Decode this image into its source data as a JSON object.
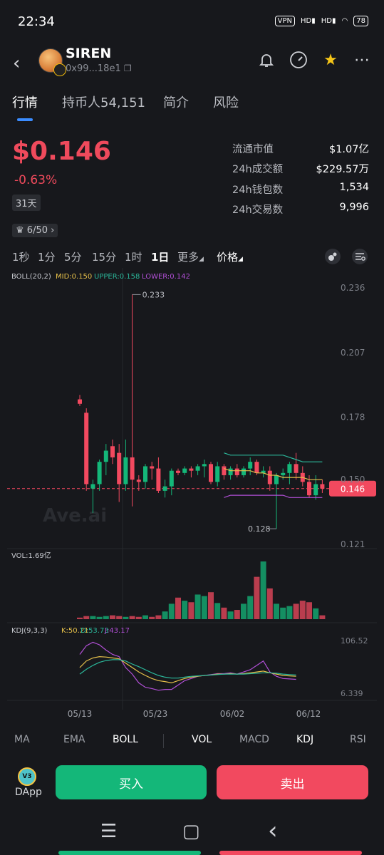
{
  "status_bar": {
    "time": "22:34",
    "vpn": "VPN",
    "hd1": "HD",
    "hd2": "HD",
    "battery": "78"
  },
  "header": {
    "back_icon": "chevron-left-icon",
    "token_name": "SIREN",
    "address": "0x99...18e1",
    "icons": [
      "copy-icon",
      "bell-icon",
      "speedometer-icon",
      "star-icon",
      "more-icon"
    ]
  },
  "tabs": [
    {
      "label": "行情",
      "active": true
    },
    {
      "label": "持币人54,151",
      "active": false
    },
    {
      "label": "简介",
      "active": false
    },
    {
      "label": "风险",
      "active": false
    }
  ],
  "price": {
    "value": "$0.146",
    "change": "-0.63%",
    "period": "31天",
    "rank": "6/50"
  },
  "stats": [
    {
      "key": "流通市值",
      "value": "$1.07亿"
    },
    {
      "key": "24h成交额",
      "value": "$229.57万"
    },
    {
      "key": "24h钱包数",
      "value": "1,534"
    },
    {
      "key": "24h交易数",
      "value": "9,996"
    }
  ],
  "intervals": [
    {
      "label": "1秒",
      "active": false
    },
    {
      "label": "1分",
      "active": false
    },
    {
      "label": "5分",
      "active": false
    },
    {
      "label": "15分",
      "active": false
    },
    {
      "label": "1时",
      "active": false
    },
    {
      "label": "1日",
      "active": true
    },
    {
      "label": "更多",
      "active": false
    },
    {
      "label": "价格",
      "active": false
    }
  ],
  "chart_data": {
    "type": "candlestick",
    "boll": {
      "label": "BOLL(20,2)",
      "mid": "MID:0.150",
      "upper": "UPPER:0.158",
      "lower": "LOWER:0.142"
    },
    "price_axis": [
      "0.236",
      "0.207",
      "0.178",
      "0.150",
      "0.121"
    ],
    "ylim": [
      0.121,
      0.236
    ],
    "current_price": "0.146",
    "high_label": "0.233",
    "low_label": "0.128",
    "watermark": "Ave.ai",
    "dates": [
      "05/13",
      "05/23",
      "06/02",
      "06/12"
    ],
    "candles": [
      [
        0.186,
        0.188,
        0.183,
        0.184
      ],
      [
        0.18,
        0.182,
        0.145,
        0.148
      ],
      [
        0.146,
        0.15,
        0.135,
        0.148
      ],
      [
        0.148,
        0.159,
        0.145,
        0.158
      ],
      [
        0.158,
        0.166,
        0.152,
        0.163
      ],
      [
        0.165,
        0.168,
        0.157,
        0.16
      ],
      [
        0.162,
        0.166,
        0.14,
        0.148
      ],
      [
        0.148,
        0.168,
        0.145,
        0.16
      ],
      [
        0.16,
        0.233,
        0.138,
        0.15
      ],
      [
        0.15,
        0.152,
        0.145,
        0.149
      ],
      [
        0.149,
        0.157,
        0.146,
        0.156
      ],
      [
        0.156,
        0.158,
        0.15,
        0.155
      ],
      [
        0.155,
        0.16,
        0.144,
        0.145
      ],
      [
        0.145,
        0.15,
        0.142,
        0.147
      ],
      [
        0.147,
        0.155,
        0.143,
        0.154
      ],
      [
        0.154,
        0.155,
        0.152,
        0.153
      ],
      [
        0.153,
        0.156,
        0.152,
        0.155
      ],
      [
        0.155,
        0.156,
        0.151,
        0.154
      ],
      [
        0.154,
        0.157,
        0.152,
        0.156
      ],
      [
        0.156,
        0.159,
        0.151,
        0.157
      ],
      [
        0.157,
        0.158,
        0.148,
        0.149
      ],
      [
        0.149,
        0.158,
        0.147,
        0.156
      ],
      [
        0.156,
        0.157,
        0.15,
        0.152
      ],
      [
        0.152,
        0.156,
        0.15,
        0.155
      ],
      [
        0.155,
        0.157,
        0.151,
        0.152
      ],
      [
        0.152,
        0.156,
        0.151,
        0.155
      ],
      [
        0.155,
        0.16,
        0.152,
        0.158
      ],
      [
        0.158,
        0.159,
        0.152,
        0.153
      ],
      [
        0.153,
        0.156,
        0.151,
        0.154
      ],
      [
        0.154,
        0.156,
        0.145,
        0.148
      ],
      [
        0.148,
        0.153,
        0.128,
        0.152
      ],
      [
        0.152,
        0.155,
        0.15,
        0.153
      ],
      [
        0.153,
        0.158,
        0.148,
        0.157
      ],
      [
        0.157,
        0.162,
        0.15,
        0.153
      ],
      [
        0.153,
        0.156,
        0.147,
        0.149
      ],
      [
        0.149,
        0.152,
        0.142,
        0.143
      ],
      [
        0.143,
        0.152,
        0.141,
        0.148
      ],
      [
        0.148,
        0.15,
        0.144,
        0.146
      ]
    ],
    "boll_mid": [
      0.15,
      0.15,
      0.15,
      0.15,
      0.15,
      0.15,
      0.15,
      0.15,
      0.15,
      0.15,
      0.15,
      0.15,
      0.15,
      0.15,
      0.15,
      0.15,
      0.15,
      0.15,
      0.15,
      0.154,
      0.155,
      0.155,
      0.155,
      0.154,
      0.154,
      0.154,
      0.154,
      0.153,
      0.153,
      0.152,
      0.152,
      0.151,
      0.151,
      0.151,
      0.151,
      0.15,
      0.15,
      0.15
    ],
    "boll_upper": [
      0.176,
      0.172,
      0.167,
      0.164,
      0.163,
      0.162,
      0.162,
      0.161,
      0.161,
      0.161,
      0.161,
      0.161,
      0.161,
      0.161,
      0.161,
      0.161,
      0.161,
      0.161,
      0.161,
      0.17,
      0.167,
      0.164,
      0.162,
      0.161,
      0.161,
      0.161,
      0.161,
      0.161,
      0.161,
      0.161,
      0.161,
      0.161,
      0.16,
      0.159,
      0.158,
      0.158,
      0.158,
      0.158
    ],
    "boll_lower": [
      0.14,
      0.14,
      0.14,
      0.14,
      0.14,
      0.14,
      0.14,
      0.14,
      0.14,
      0.14,
      0.14,
      0.14,
      0.14,
      0.14,
      0.14,
      0.14,
      0.14,
      0.14,
      0.14,
      0.137,
      0.14,
      0.141,
      0.142,
      0.143,
      0.143,
      0.143,
      0.143,
      0.143,
      0.143,
      0.143,
      0.143,
      0.143,
      0.142,
      0.142,
      0.142,
      0.142,
      0.142,
      0.142
    ],
    "volume": {
      "label": "VOL:1.69亿",
      "values": [
        2,
        4,
        4,
        3,
        4,
        5,
        4,
        3,
        4,
        3,
        5,
        3,
        5,
        10,
        20,
        28,
        24,
        22,
        32,
        30,
        35,
        21,
        15,
        10,
        12,
        20,
        30,
        55,
        75,
        40,
        20,
        15,
        17,
        20,
        24,
        22,
        14,
        5
      ]
    },
    "kdj": {
      "label": "KDJ(9,3,3)",
      "k": "K:50.21",
      "d": "D:53.73",
      "j": "J:43.17",
      "axis": [
        "106.52",
        "6.339"
      ],
      "K": [
        70,
        85,
        92,
        95,
        94,
        92,
        90,
        80,
        70,
        60,
        52,
        45,
        40,
        38,
        35,
        40,
        45,
        48,
        50,
        52,
        53,
        55,
        55,
        56,
        55,
        56,
        58,
        60,
        62,
        58,
        55,
        52,
        51,
        50
      ],
      "D": [
        55,
        66,
        75,
        82,
        86,
        88,
        88,
        85,
        78,
        72,
        65,
        58,
        52,
        48,
        46,
        46,
        48,
        50,
        51,
        52,
        53,
        54,
        55,
        55,
        55,
        55,
        56,
        57,
        58,
        58,
        57,
        55,
        54,
        53
      ],
      "J": [
        100,
        120,
        128,
        122,
        110,
        100,
        95,
        70,
        55,
        35,
        25,
        22,
        18,
        20,
        20,
        30,
        40,
        45,
        50,
        52,
        54,
        56,
        56,
        58,
        55,
        60,
        65,
        75,
        85,
        60,
        50,
        45,
        44,
        43
      ]
    }
  },
  "indicator_tabs": [
    {
      "label": "MA",
      "on": false
    },
    {
      "label": "EMA",
      "on": false
    },
    {
      "label": "BOLL",
      "on": true
    },
    {
      "label": "VOL",
      "on": true
    },
    {
      "label": "MACD",
      "on": false
    },
    {
      "label": "KDJ",
      "on": true
    },
    {
      "label": "RSI",
      "on": false
    }
  ],
  "actions": {
    "dapp_label": "DApp",
    "dapp_badge": "V3",
    "buy": "买入",
    "sell": "卖出"
  },
  "nav": {
    "menu": "☰",
    "home": "▢",
    "back": "‹"
  },
  "colors": {
    "up": "#14b779",
    "down": "#f2495f",
    "mid": "#e6c04a",
    "upper": "#2bb79a",
    "lower": "#b14fd6"
  }
}
